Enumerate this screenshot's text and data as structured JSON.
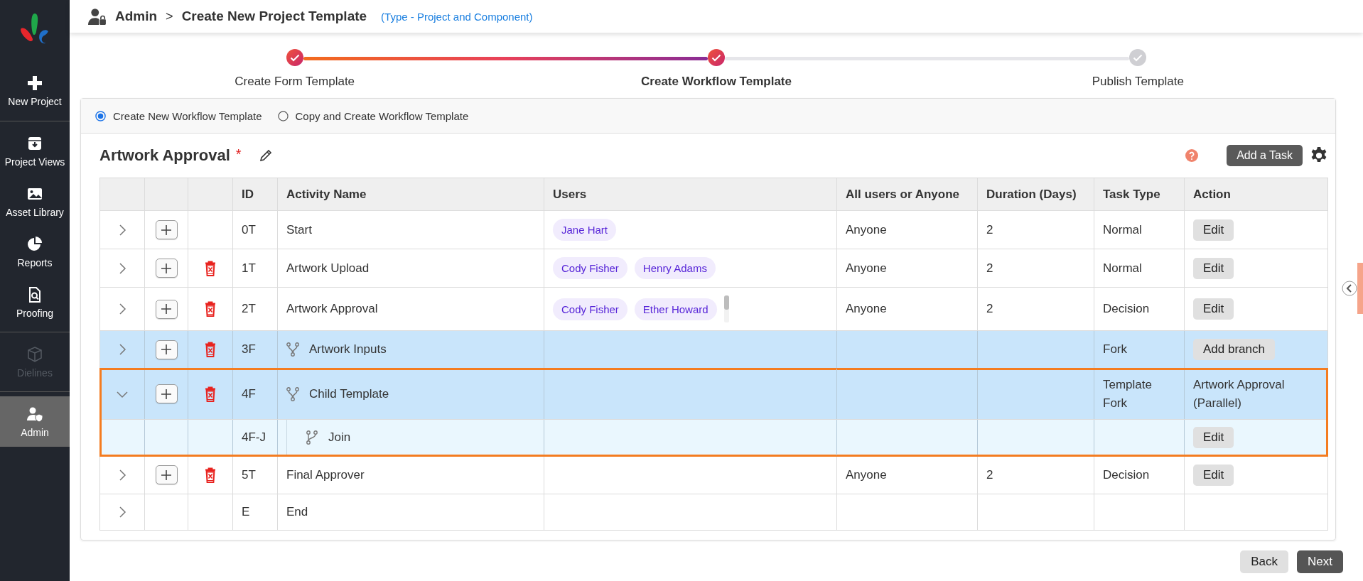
{
  "sidebar": {
    "groups": [
      [
        {
          "label": "New Project",
          "selected": false,
          "disabled": false
        }
      ],
      [
        {
          "label": "Project Views",
          "selected": false,
          "disabled": false
        },
        {
          "label": "Asset Library",
          "selected": false,
          "disabled": false
        },
        {
          "label": "Reports",
          "selected": false,
          "disabled": false
        },
        {
          "label": "Proofing",
          "selected": false,
          "disabled": false
        }
      ],
      [
        {
          "label": "Dielines",
          "selected": false,
          "disabled": true
        }
      ],
      [
        {
          "label": "Admin",
          "selected": true,
          "disabled": false
        }
      ]
    ]
  },
  "header": {
    "breadcrumb": [
      "Admin",
      "Create New Project Template"
    ],
    "separator": ">",
    "type_note": "(Type - Project and Component)"
  },
  "stepper": [
    {
      "label": "Create Form Template",
      "complete": true,
      "selected": false
    },
    {
      "label": "Create Workflow Template",
      "complete": true,
      "selected": true
    },
    {
      "label": "Publish Template",
      "complete": false,
      "selected": false
    }
  ],
  "mode_options": [
    {
      "label": "Create New Workflow Template",
      "selected": true
    },
    {
      "label": "Copy and Create Workflow Template",
      "selected": false
    }
  ],
  "workflow": {
    "title": "Artwork Approval",
    "required_mark": "*",
    "add_task_button": "Add a Task"
  },
  "table": {
    "columns": [
      "ID",
      "Activity Name",
      "Users",
      "All users or Anyone",
      "Duration (Days)",
      "Task Type",
      "Action"
    ],
    "rows": [
      {
        "kind": "task",
        "expanded": false,
        "can_add": true,
        "can_delete": false,
        "outlined": false,
        "id": "0T",
        "name": "Start",
        "users": [
          "Jane Hart"
        ],
        "assign": "Anyone",
        "duration": "2",
        "task_type": "Normal",
        "action": {
          "kind": "button",
          "label": "Edit"
        }
      },
      {
        "kind": "task",
        "expanded": false,
        "can_add": true,
        "can_delete": true,
        "outlined": false,
        "id": "1T",
        "name": "Artwork Upload",
        "users": [
          "Cody Fisher",
          "Henry Adams"
        ],
        "assign": "Anyone",
        "duration": "2",
        "task_type": "Normal",
        "action": {
          "kind": "button",
          "label": "Edit"
        }
      },
      {
        "kind": "task",
        "expanded": false,
        "can_add": true,
        "can_delete": true,
        "outlined": false,
        "id": "2T",
        "name": "Artwork Approval",
        "users": [
          "Cody Fisher",
          "Ether Howard"
        ],
        "users_scroll": true,
        "assign": "Anyone",
        "duration": "2",
        "task_type": "Decision",
        "action": {
          "kind": "button",
          "label": "Edit"
        }
      },
      {
        "kind": "fork",
        "expanded": false,
        "can_add": true,
        "can_delete": true,
        "outlined": false,
        "id": "3F",
        "name": "Artwork Inputs",
        "users": [],
        "assign": "",
        "duration": "",
        "task_type": "Fork",
        "action": {
          "kind": "button",
          "label": "Add branch"
        }
      },
      {
        "kind": "fork",
        "expanded": true,
        "can_add": true,
        "can_delete": true,
        "outlined": true,
        "id": "4F",
        "name": "Child Template",
        "users": [],
        "assign": "",
        "duration": "",
        "task_type": "Template Fork",
        "action": {
          "kind": "text",
          "label": "Artwork Approval (Parallel)"
        },
        "children": [
          {
            "kind": "join",
            "id": "4F-J",
            "name": "Join",
            "action": {
              "kind": "button",
              "label": "Edit"
            }
          }
        ]
      },
      {
        "kind": "task",
        "expanded": false,
        "can_add": true,
        "can_delete": true,
        "outlined": false,
        "id": "5T",
        "name": "Final Approver",
        "users": [],
        "assign": "Anyone",
        "duration": "2",
        "task_type": "Decision",
        "action": {
          "kind": "button",
          "label": "Edit"
        }
      },
      {
        "kind": "end",
        "expanded": false,
        "can_add": false,
        "can_delete": false,
        "outlined": false,
        "id": "E",
        "name": "End",
        "users": [],
        "action": {
          "kind": "none"
        }
      }
    ]
  },
  "footer": {
    "back_button": "Back",
    "next_button": "Next"
  }
}
